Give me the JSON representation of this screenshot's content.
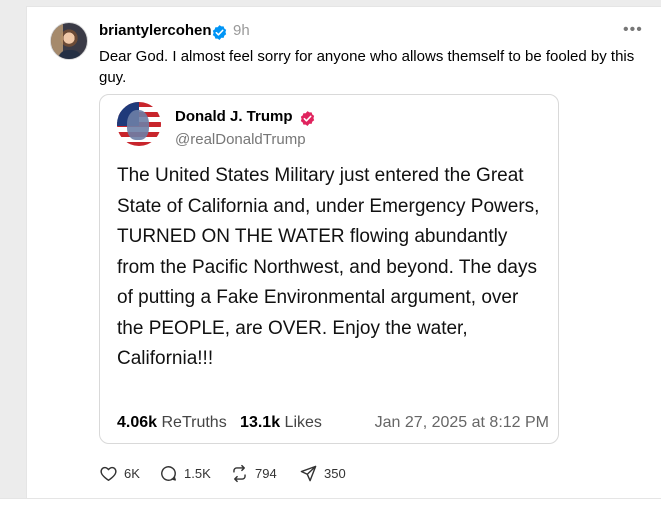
{
  "post": {
    "username": "briantylercohen",
    "time": "9h",
    "more_label": "•••",
    "text": "Dear God. I almost feel sorry for anyone who allows themself to be fooled by this guy."
  },
  "quote": {
    "name": "Donald J. Trump",
    "handle": "@realDonaldTrump",
    "body": "The United States Military just entered the Great State of California and, under Emergency Powers, TURNED ON THE WATER flowing abundantly from the Pacific Northwest, and beyond. The days of putting a Fake Environmental argument, over the PEOPLE, are OVER. Enjoy the water, California!!!",
    "retruths_count": "4.06k",
    "retruths_label": "ReTruths",
    "likes_count": "13.1k",
    "likes_label": "Likes",
    "date": "Jan 27, 2025 at 8:12 PM"
  },
  "actions": {
    "likes": "6K",
    "replies": "1.5K",
    "reposts": "794",
    "shares": "350"
  },
  "colors": {
    "verified_blue": "#0095f6",
    "verified_pink": "#e0245e",
    "meta_gray": "#999999"
  },
  "icons": [
    "heart-icon",
    "comment-icon",
    "repost-icon",
    "share-icon",
    "verified-icon",
    "more-icon"
  ]
}
